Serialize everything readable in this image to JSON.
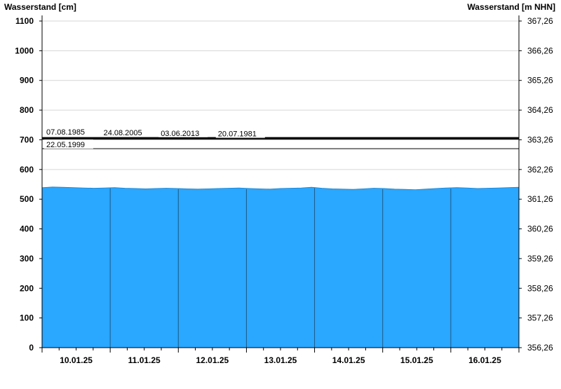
{
  "chart_data": {
    "type": "area",
    "left_axis": {
      "title": "Wasserstand [cm]",
      "range": [
        0,
        1100
      ],
      "ticks": [
        "0",
        "100",
        "200",
        "300",
        "400",
        "500",
        "600",
        "700",
        "800",
        "900",
        "1000",
        "1100"
      ]
    },
    "right_axis": {
      "title": "Wasserstand [m NHN]",
      "ticks": [
        "356,26",
        "357,26",
        "358,26",
        "359,26",
        "360,26",
        "361,26",
        "362,26",
        "363,26",
        "364,26",
        "365,26",
        "366,26",
        "367,26"
      ]
    },
    "x_axis": {
      "day_labels": [
        "10.01.25",
        "11.01.25",
        "12.01.25",
        "13.01.25",
        "14.01.25",
        "15.01.25",
        "16.01.25"
      ]
    },
    "grid": true,
    "fill_color": "#2aa7ff",
    "series": [
      {
        "values": [
          539,
          541,
          540,
          539,
          538,
          537,
          538,
          539,
          537,
          536,
          535,
          536,
          537,
          536,
          535,
          534,
          535,
          536,
          537,
          538,
          536,
          535,
          534,
          536,
          537,
          538,
          540,
          537,
          535,
          534,
          533,
          535,
          537,
          536,
          534,
          533,
          532,
          534,
          536,
          538,
          539,
          538,
          536,
          537,
          538,
          539,
          540
        ]
      }
    ],
    "reference_lines": [
      {
        "label": "07.08.1985",
        "value": 708
      },
      {
        "label": "24.08.2005",
        "value": 706
      },
      {
        "label": "03.06.2013",
        "value": 704
      },
      {
        "label": "20.07.1981",
        "value": 702
      },
      {
        "label": "22.05.1999",
        "value": 670
      }
    ]
  }
}
